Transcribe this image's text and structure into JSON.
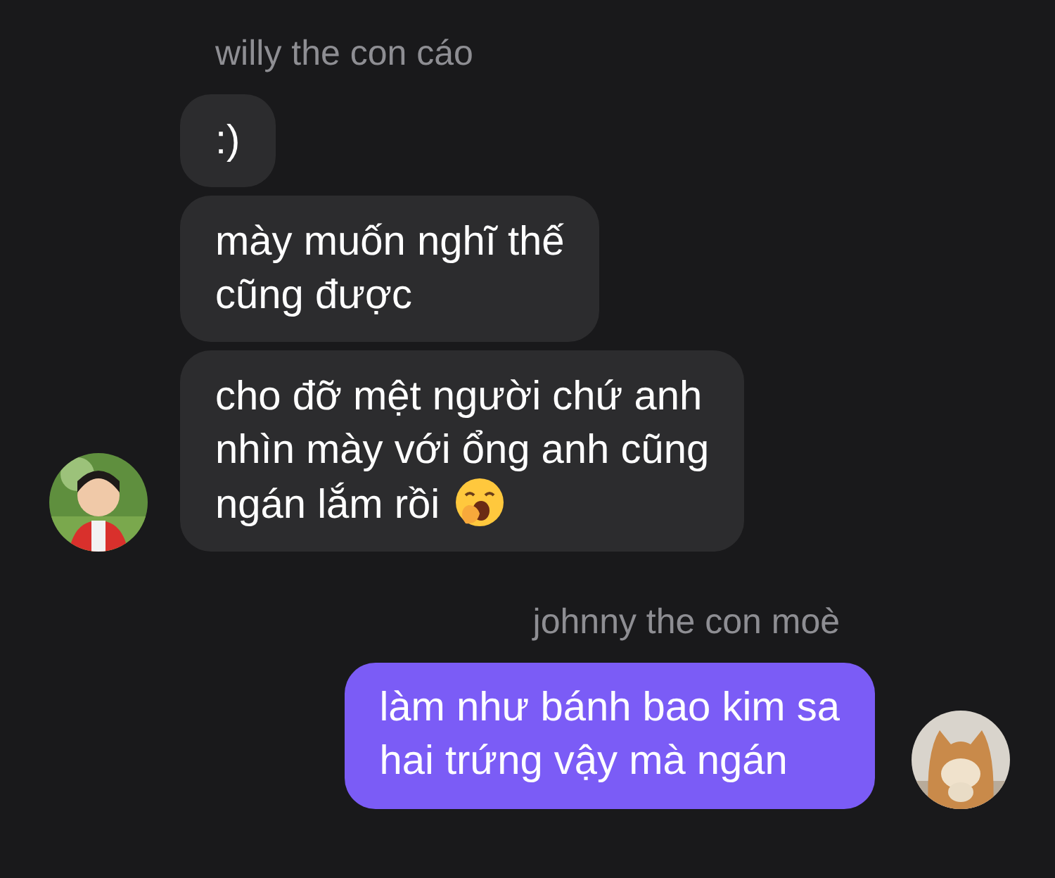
{
  "conversation": [
    {
      "kind": "incoming",
      "sender": "willy the con cáo",
      "avatar": {
        "kind": "picture"
      },
      "messages": [
        {
          "kind": "plain",
          "text": ":)"
        },
        {
          "kind": "plain",
          "text": "mày muốn nghĩ thế\ncũng được"
        },
        {
          "kind": "with_emoji",
          "text": "cho đỡ mệt người chứ anh\nnhìn mày với ổng anh cũng\nngán lắm rồi"
        }
      ]
    },
    {
      "kind": "outgoing",
      "sender": "johnny the con moè",
      "avatar": {
        "kind": "picture"
      },
      "messages": [
        {
          "kind": "plain",
          "text": "làm như bánh bao kim sa\nhai trứng vậy mà ngán"
        }
      ]
    }
  ]
}
